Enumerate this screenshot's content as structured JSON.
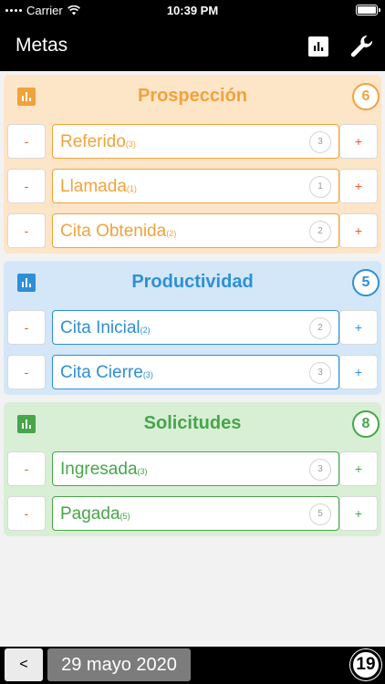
{
  "status": {
    "carrier": "Carrier",
    "time": "10:39 PM"
  },
  "nav": {
    "title": "Metas",
    "chart_icon": "bar-chart-icon",
    "settings_icon": "wrench-icon"
  },
  "colors": {
    "orange": "#f0a33c",
    "blue": "#2e8fd6",
    "green": "#46a649",
    "minus": "#e55b2f"
  },
  "sections": [
    {
      "title": "Prospección",
      "total": "6",
      "items": [
        {
          "minus": "-",
          "label": "Referido",
          "sub": "(3)",
          "count": "3",
          "plus": "+"
        },
        {
          "minus": "-",
          "label": "Llamada",
          "sub": "(1)",
          "count": "1",
          "plus": "+"
        },
        {
          "minus": "-",
          "label": "Cita Obtenida",
          "sub": "(2)",
          "count": "2",
          "plus": "+"
        }
      ]
    },
    {
      "title": "Productividad",
      "total": "5",
      "items": [
        {
          "minus": "-",
          "label": "Cita Inicial",
          "sub": "(2)",
          "count": "2",
          "plus": "+"
        },
        {
          "minus": "-",
          "label": "Cita Cierre",
          "sub": "(3)",
          "count": "3",
          "plus": "+"
        }
      ]
    },
    {
      "title": "Solicitudes",
      "total": "8",
      "items": [
        {
          "minus": "-",
          "label": "Ingresada",
          "sub": "(3)",
          "count": "3",
          "plus": "+"
        },
        {
          "minus": "-",
          "label": "Pagada",
          "sub": "(5)",
          "count": "5",
          "plus": "+"
        }
      ]
    }
  ],
  "footer": {
    "prev_label": "<",
    "date": "29 mayo 2020",
    "total": "19"
  }
}
